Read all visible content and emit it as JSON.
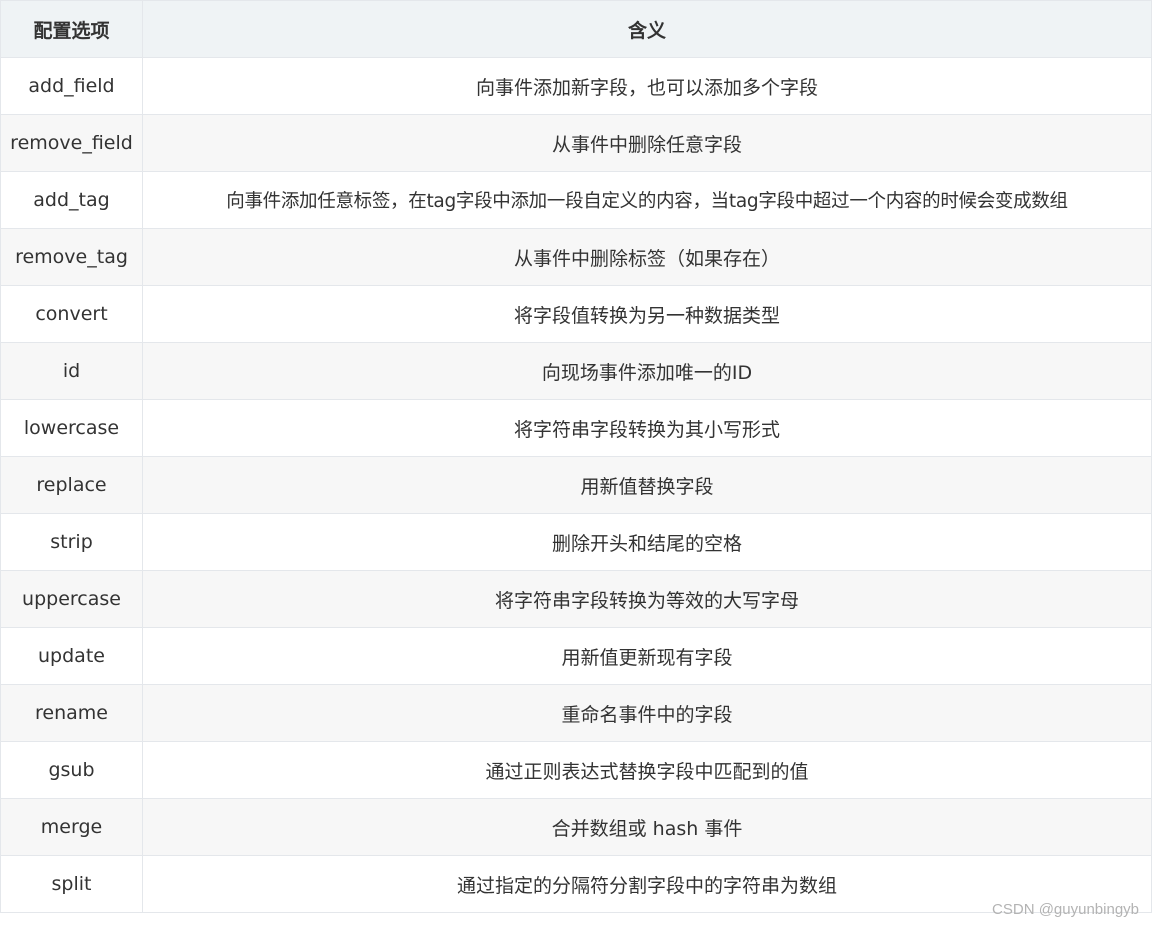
{
  "table": {
    "headers": [
      "配置选项",
      "含义"
    ],
    "rows": [
      {
        "option": "add_field",
        "meaning": "向事件添加新字段，也可以添加多个字段"
      },
      {
        "option": "remove_field",
        "meaning": "从事件中删除任意字段"
      },
      {
        "option": "add_tag",
        "meaning": "向事件添加任意标签，在tag字段中添加一段自定义的内容，当tag字段中超过一个内容的时候会变成数组"
      },
      {
        "option": "remove_tag",
        "meaning": "从事件中删除标签（如果存在）"
      },
      {
        "option": "convert",
        "meaning": "将字段值转换为另一种数据类型"
      },
      {
        "option": "id",
        "meaning": "向现场事件添加唯一的ID"
      },
      {
        "option": "lowercase",
        "meaning": "将字符串字段转换为其小写形式"
      },
      {
        "option": "replace",
        "meaning": "用新值替换字段"
      },
      {
        "option": "strip",
        "meaning": "删除开头和结尾的空格"
      },
      {
        "option": "uppercase",
        "meaning": "将字符串字段转换为等效的大写字母"
      },
      {
        "option": "update",
        "meaning": "用新值更新现有字段"
      },
      {
        "option": "rename",
        "meaning": "重命名事件中的字段"
      },
      {
        "option": "gsub",
        "meaning": "通过正则表达式替换字段中匹配到的值"
      },
      {
        "option": "merge",
        "meaning": "合并数组或 hash 事件"
      },
      {
        "option": "split",
        "meaning": "通过指定的分隔符分割字段中的字符串为数组"
      }
    ]
  },
  "watermark": "CSDN @guyunbingyb"
}
